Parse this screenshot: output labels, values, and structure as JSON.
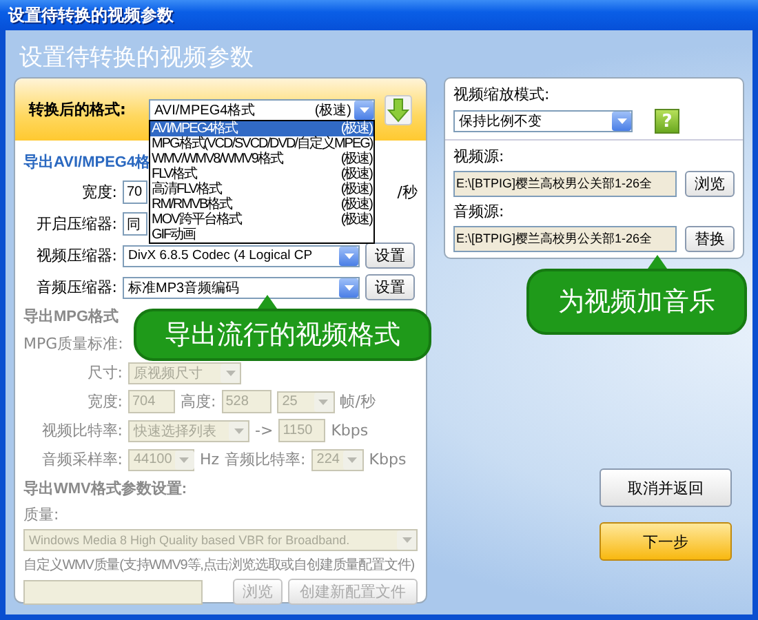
{
  "window": {
    "title": "设置待转换的视频参数"
  },
  "heading": "设置待转换的视频参数",
  "format": {
    "label": "转换后的格式:",
    "value": "AVI/MPEG4格式",
    "tag": "(极速)",
    "options": [
      {
        "name": "AVI/MPEG4格式",
        "tag": "(极速)",
        "selected": true
      },
      {
        "name": "MPG格式(VCD/SVCD/DVD/自定义MPEG)",
        "selected": false
      },
      {
        "name": "WMV/WMV8/WMV9格式",
        "tag": "(极速)",
        "selected": false
      },
      {
        "name": "FLV格式",
        "tag": "(极速)",
        "selected": false
      },
      {
        "name": "高清FLV格式",
        "tag": "(极速)",
        "selected": false
      },
      {
        "name": "RM/RMVB格式",
        "tag": "(极速)",
        "selected": false
      },
      {
        "name": "MOV跨平台格式",
        "tag": "(极速)",
        "selected": false
      },
      {
        "name": "GIF动画",
        "selected": false
      }
    ]
  },
  "avi": {
    "title": "导出AVI/MPEG4格",
    "disabled": false,
    "width_label": "宽度:",
    "width_value": "70",
    "fps_unit": "/秒",
    "compressor_label": "开启压缩器:",
    "compressor_value": "同",
    "video_label": "视频压缩器:",
    "video_value": "DivX 6.8.5 Codec (4 Logical CP",
    "video_button": "设置",
    "audio_label": "音频压缩器:",
    "audio_value": "标准MP3音频编码",
    "audio_button": "设置"
  },
  "mpg": {
    "title": "导出MPG格式",
    "disabled": true,
    "quality_label": "MPG质量标准:",
    "size_label": "尺寸:",
    "size_value": "原视频尺寸",
    "width_label": "宽度:",
    "width_value": "704",
    "height_label": "高度:",
    "height_value": "528",
    "fps_value": "25",
    "fps_unit": "帧/秒",
    "vbitrate_label": "视频比特率:",
    "vbitrate_value": "快速选择列表",
    "arrow": "->",
    "vbitrate_number": "1150",
    "vbitrate_unit": "Kbps",
    "samplerate_label": "音频采样率:",
    "samplerate_value": "44100",
    "samplerate_unit": "Hz",
    "abitrate_label": "音频比特率:",
    "abitrate_value": "224",
    "abitrate_unit": "Kbps"
  },
  "wmv": {
    "title": "导出WMV格式参数设置:",
    "disabled": true,
    "quality_label": "质量:",
    "quality_value": "Windows Media 8 High Quality based VBR for Broadband.",
    "custom_label": "自定义WMV质量(支持WMV9等,点击浏览选取或自创建质量配置文件)",
    "browse_button": "浏览",
    "create_button": "创建新配置文件"
  },
  "scale": {
    "label": "视频缩放模式:",
    "value": "保持比例不变",
    "help": "?"
  },
  "video_source": {
    "label": "视频源:",
    "value": "E:\\[BTPIG]樱兰高校男公关部1-26全",
    "button": "浏览"
  },
  "audio_source": {
    "label": "音频源:",
    "value": "E:\\[BTPIG]樱兰高校男公关部1-26全",
    "button": "替换"
  },
  "callouts": [
    "导出流行的视频格式",
    "为视频加音乐"
  ],
  "buttons": {
    "cancel": "取消并返回",
    "next": "下一步"
  }
}
